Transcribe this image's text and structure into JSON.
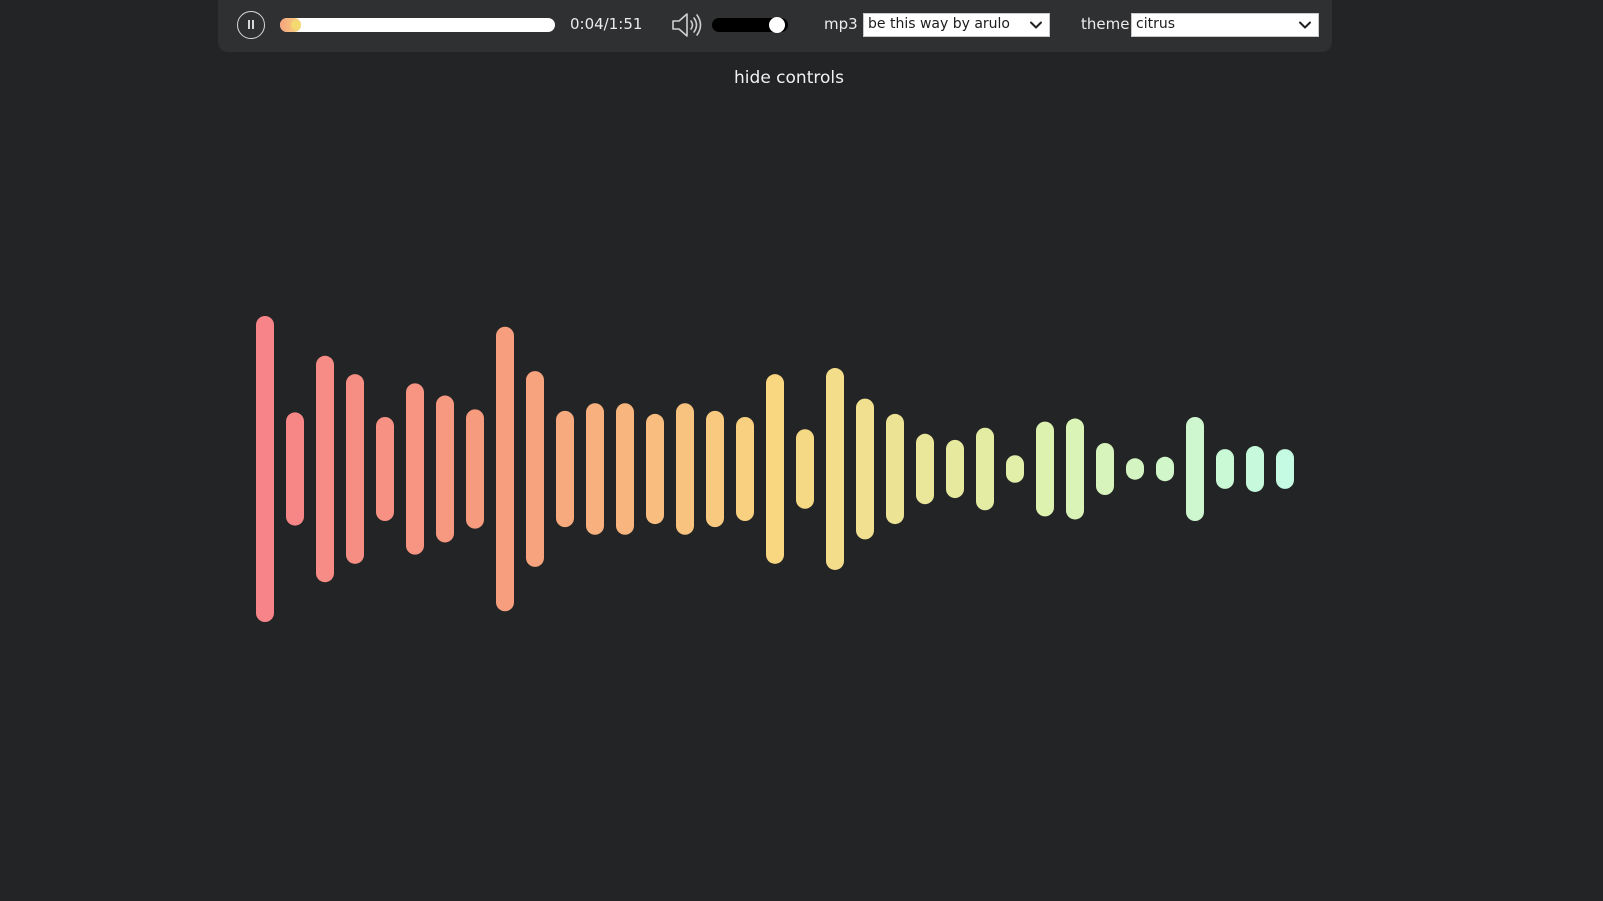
{
  "player": {
    "play_state": "playing",
    "time_text": "0:04/1:51",
    "progress_fraction": 0.036,
    "volume_fraction": 0.95,
    "mp3_label": "mp3",
    "mp3_selected": "be this way by arulo",
    "theme_label": "theme",
    "theme_selected": "citrus"
  },
  "hide_controls_label": "hide controls",
  "icons": {
    "play_pause": "pause-icon",
    "volume": "speaker-icon",
    "dropdown": "chevron-down-icon"
  },
  "visualizer": {
    "bar_levels": [
      1.0,
      0.37,
      0.74,
      0.62,
      0.34,
      0.56,
      0.48,
      0.39,
      0.93,
      0.64,
      0.38,
      0.43,
      0.43,
      0.36,
      0.43,
      0.38,
      0.34,
      0.62,
      0.26,
      0.66,
      0.46,
      0.36,
      0.23,
      0.19,
      0.27,
      0.09,
      0.31,
      0.33,
      0.17,
      0.07,
      0.08,
      0.34,
      0.13,
      0.15,
      0.13
    ],
    "colors": [
      "#f78488",
      "#f7a07d",
      "#f9d680",
      "#dff1ac",
      "#c4fbe2"
    ]
  },
  "colors": {
    "background": "#232425",
    "controls_bg": "#2f3032"
  }
}
